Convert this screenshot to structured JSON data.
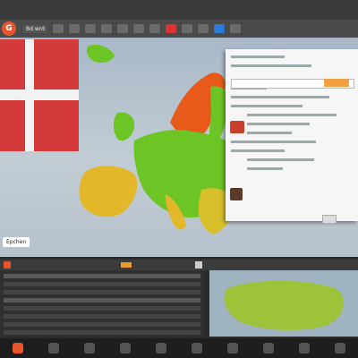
{
  "toolbar": {
    "logo_glyph": "G",
    "menu_label_1": "Bd wrd",
    "menu_label_2": "",
    "menu_label_3": ""
  },
  "map": {
    "caption": "Epchen"
  },
  "lower_bar": {
    "label": ""
  },
  "colors": {
    "brand": "#e8552a",
    "flag_red": "#d43a3a",
    "map_green": "#6cc524",
    "map_orange": "#e85a1a",
    "map_yellow": "#e2b82a",
    "accent_blue": "#2a7ad6"
  },
  "icons": {
    "logo": "app-logo-icon",
    "search": "search-icon",
    "close": "close-icon"
  }
}
